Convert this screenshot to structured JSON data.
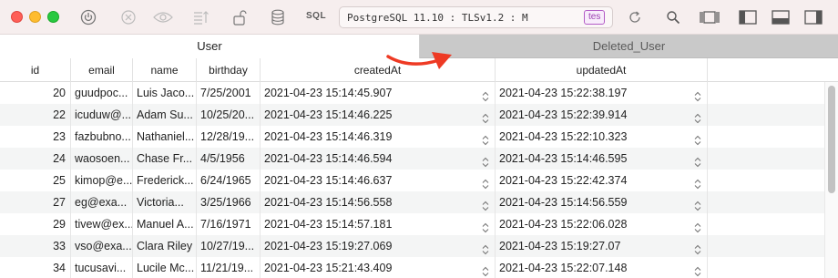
{
  "toolbar": {
    "sql_label": "SQL",
    "connection_text": "PostgreSQL 11.10 : TLSv1.2 : M",
    "connection_badge": "tes",
    "badge_color": "#9b3fb0",
    "icons": [
      "power-icon",
      "close-circle-icon",
      "eye-icon",
      "sort-icon",
      "lock-icon",
      "database-icon",
      "refresh-icon",
      "search-icon",
      "panels-icon",
      "left-sidebar-icon",
      "bottom-panel-icon",
      "right-sidebar-icon"
    ]
  },
  "tabs": [
    {
      "label": "User",
      "active": true
    },
    {
      "label": "Deleted_User",
      "active": false
    }
  ],
  "annotation": {
    "arrow_color": "#ee3a24"
  },
  "table": {
    "columns": [
      "id",
      "email",
      "name",
      "birthday",
      "createdAt",
      "updatedAt"
    ],
    "rows": [
      {
        "id": "20",
        "email": "guudpoc...",
        "name": "Luis Jaco...",
        "birthday": "7/25/2001",
        "createdAt": "2021-04-23 15:14:45.907",
        "updatedAt": "2021-04-23 15:22:38.197"
      },
      {
        "id": "22",
        "email": "icuduw@...",
        "name": "Adam Su...",
        "birthday": "10/25/20...",
        "createdAt": "2021-04-23 15:14:46.225",
        "updatedAt": "2021-04-23 15:22:39.914"
      },
      {
        "id": "23",
        "email": "fazbubno...",
        "name": "Nathaniel...",
        "birthday": "12/28/19...",
        "createdAt": "2021-04-23 15:14:46.319",
        "updatedAt": "2021-04-23 15:22:10.323"
      },
      {
        "id": "24",
        "email": "waosoen...",
        "name": "Chase Fr...",
        "birthday": "4/5/1956",
        "createdAt": "2021-04-23 15:14:46.594",
        "updatedAt": "2021-04-23 15:14:46.595"
      },
      {
        "id": "25",
        "email": "kimop@e...",
        "name": "Frederick...",
        "birthday": "6/24/1965",
        "createdAt": "2021-04-23 15:14:46.637",
        "updatedAt": "2021-04-23 15:22:42.374"
      },
      {
        "id": "27",
        "email": "eg@exa...",
        "name": "Victoria...",
        "birthday": "3/25/1966",
        "createdAt": "2021-04-23 15:14:56.558",
        "updatedAt": "2021-04-23 15:14:56.559"
      },
      {
        "id": "29",
        "email": "tivew@ex...",
        "name": "Manuel A...",
        "birthday": "7/16/1971",
        "createdAt": "2021-04-23 15:14:57.181",
        "updatedAt": "2021-04-23 15:22:06.028"
      },
      {
        "id": "33",
        "email": "vso@exa...",
        "name": "Clara Riley",
        "birthday": "10/27/19...",
        "createdAt": "2021-04-23 15:19:27.069",
        "updatedAt": "2021-04-23 15:19:27.07"
      },
      {
        "id": "34",
        "email": "tucusavi...",
        "name": "Lucile Mc...",
        "birthday": "11/21/19...",
        "createdAt": "2021-04-23 15:21:43.409",
        "updatedAt": "2021-04-23 15:22:07.148"
      }
    ]
  }
}
